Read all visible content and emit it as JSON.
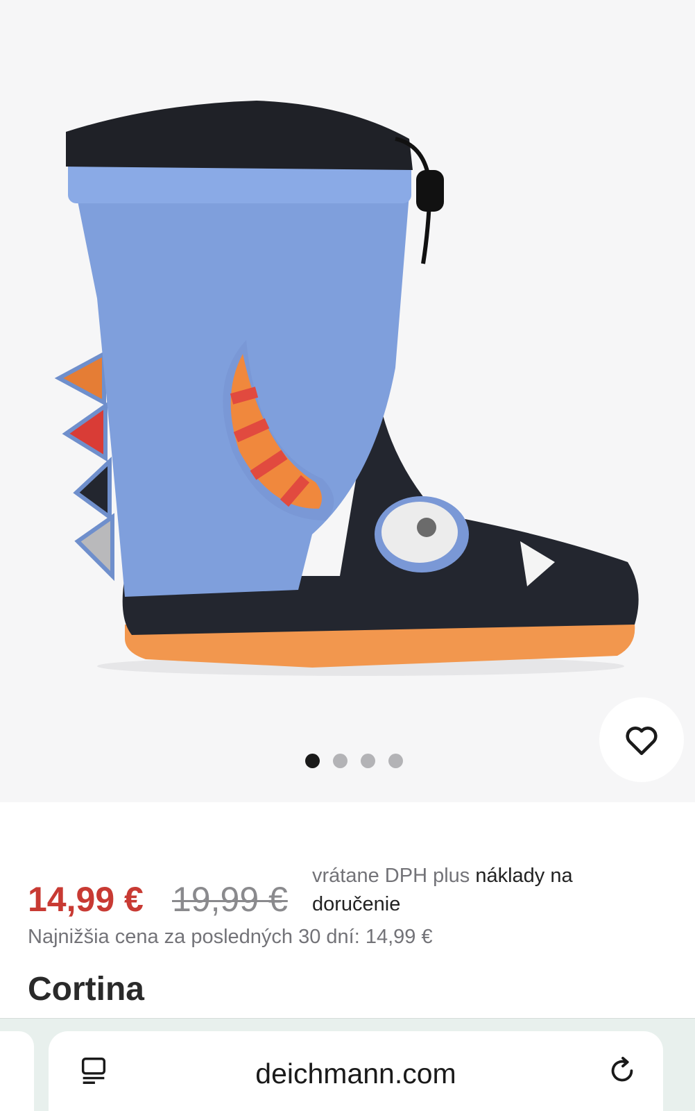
{
  "gallery": {
    "image_alt": "",
    "slide_count": 4,
    "active_slide": 1,
    "colors": {
      "shaft": "#7f9fdc",
      "rubber": "#23262f",
      "sole": "#f2974e",
      "horn_red": "#e14a3f",
      "horn_orange": "#f0883d"
    }
  },
  "wishlist": {
    "icon": "heart-icon"
  },
  "price": {
    "current": "14,99 €",
    "original": "19,99 €",
    "vat_prefix": "vrátane DPH plus",
    "vat_link": "náklady na doručenie",
    "lowest": "Najnižšia cena za posledných 30 dní: 14,99 €",
    "accent_color": "#c83a33"
  },
  "product": {
    "name": "Cortina"
  },
  "browser": {
    "url": "deichmann.com",
    "reader_icon": "reader-mode-icon",
    "reload_icon": "reload-icon"
  }
}
